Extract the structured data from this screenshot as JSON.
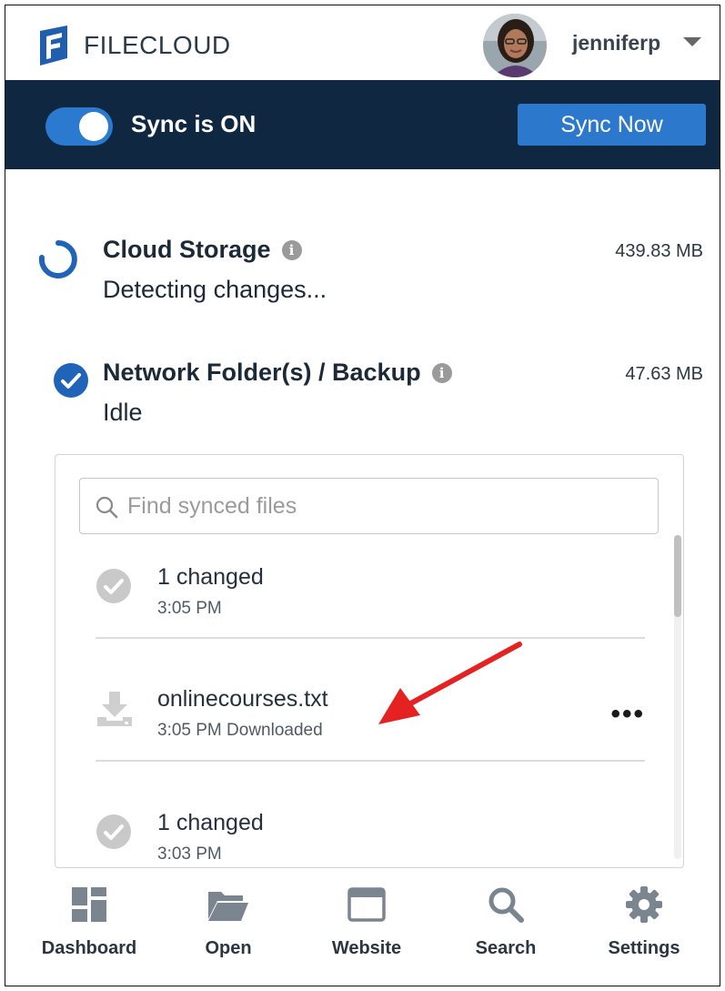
{
  "header": {
    "logo_text": "FILECLOUD",
    "username": "jenniferp"
  },
  "syncbar": {
    "status": "Sync is ON",
    "sync_now_label": "Sync Now",
    "toggle_on": true
  },
  "storage": [
    {
      "title": "Cloud Storage",
      "status": "Detecting changes...",
      "size": "439.83 MB",
      "icon": "spinner-icon"
    },
    {
      "title": "Network Folder(s) / Backup",
      "status": "Idle",
      "size": "47.63 MB",
      "icon": "check-circle-icon"
    }
  ],
  "files": {
    "search_placeholder": "Find synced files",
    "items": [
      {
        "title": "1 changed",
        "sub": "3:05 PM",
        "icon": "check-circle-icon"
      },
      {
        "title": "onlinecourses.txt",
        "sub": "3:05 PM Downloaded",
        "icon": "download-icon"
      },
      {
        "title": "1 changed",
        "sub": "3:03 PM",
        "icon": "check-circle-icon"
      }
    ]
  },
  "nav": [
    {
      "label": "Dashboard",
      "icon": "dashboard-icon"
    },
    {
      "label": "Open",
      "icon": "folder-open-icon"
    },
    {
      "label": "Website",
      "icon": "browser-window-icon"
    },
    {
      "label": "Search",
      "icon": "search-icon"
    },
    {
      "label": "Settings",
      "icon": "gear-icon"
    }
  ],
  "colors": {
    "brand_dark": "#0f2740",
    "accent_blue": "#2b78cc",
    "annotation_red": "#e52222"
  }
}
